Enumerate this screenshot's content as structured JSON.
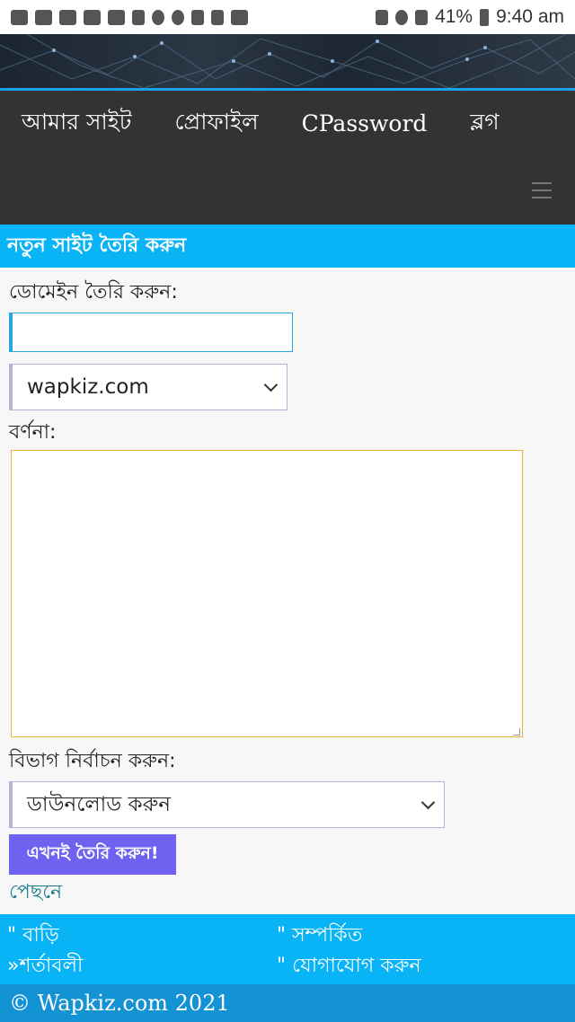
{
  "status_bar": {
    "battery": "41%",
    "time": "9:40 am",
    "icons": [
      "chat-icon",
      "youtube-icon",
      "youtube-icon",
      "youtube-icon",
      "youtube-icon",
      "nfc-icon",
      "bell-icon",
      "bell-icon",
      "shield-icon",
      "sync-icon",
      "image-icon",
      "recycle-icon",
      "alarm-icon",
      "signal-icon",
      "battery-icon"
    ]
  },
  "nav": {
    "items": [
      "আমার সাইট",
      "প্রোফাইল",
      "CPassword",
      "ব্লগ"
    ]
  },
  "section": {
    "title": "নতুন সাইট তৈরি করুন"
  },
  "form": {
    "domain_label": "ডোমেইন তৈরি করুন:",
    "domain_value": "",
    "domain_suffix_selected": "wapkiz.com",
    "description_label": "বর্ণনা:",
    "description_value": "",
    "category_label": "বিভাগ নির্বাচন করুন:",
    "category_selected": "ডাউনলোড করুন",
    "submit_label": "এখনই তৈরি করুন!",
    "back_label": "পেছনে"
  },
  "footer": {
    "links": [
      "\" বাড়ি",
      "\" সম্পর্কিত",
      "»শর্তাবলী",
      "\" যোগাযোগ করুন"
    ],
    "copyright": "© Wapkiz.com 2021"
  },
  "colors": {
    "accent": "#09b4f6",
    "nav_bg": "#333333",
    "button": "#6f62f0"
  }
}
